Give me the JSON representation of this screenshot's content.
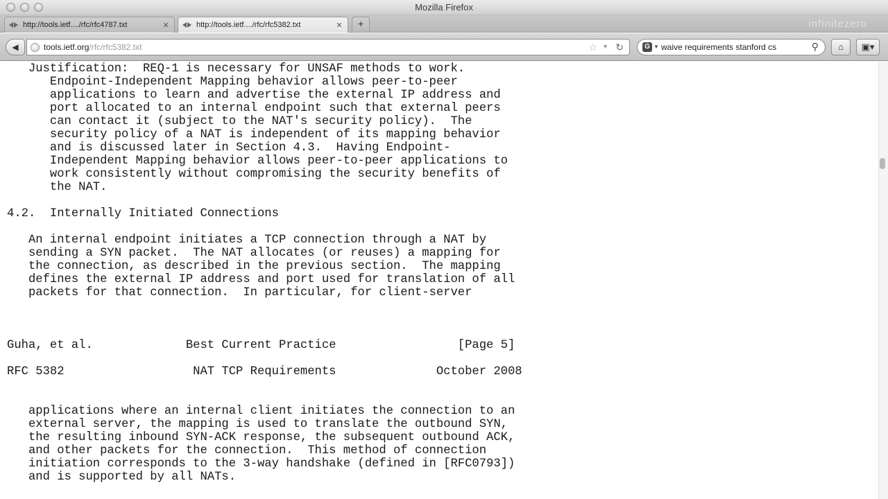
{
  "window": {
    "title": "Mozilla Firefox",
    "watermark": "infinitezero"
  },
  "tabs": [
    {
      "label": "http://tools.ietf..../rfc/rfc4787.txt",
      "close": "✕",
      "active": false
    },
    {
      "label": "http://tools.ietf..../rfc/rfc5382.txt",
      "close": "✕",
      "active": true
    }
  ],
  "newtab": {
    "label": "+"
  },
  "navbar": {
    "back_icon": "◀",
    "url_host": "tools.ietf.org",
    "url_path": "/rfc/rfc5382.txt",
    "star_icon": "☆",
    "drop_icon": "▼",
    "reload_icon": "↻",
    "search_value": "waive requirements stanford cs",
    "search_engine_letter": "G",
    "search_engine_drop": "▼",
    "search_icon": "⚲",
    "home_icon": "⌂",
    "addon_icon": "▣▾"
  },
  "document": {
    "lines": [
      "   Justification:  REQ-1 is necessary for UNSAF methods to work.",
      "      Endpoint-Independent Mapping behavior allows peer-to-peer",
      "      applications to learn and advertise the external IP address and",
      "      port allocated to an internal endpoint such that external peers",
      "      can contact it (subject to the NAT's security policy).  The",
      "      security policy of a NAT is independent of its mapping behavior",
      "      and is discussed later in Section 4.3.  Having Endpoint-",
      "      Independent Mapping behavior allows peer-to-peer applications to",
      "      work consistently without compromising the security benefits of",
      "      the NAT.",
      "",
      "4.2.  Internally Initiated Connections",
      "",
      "   An internal endpoint initiates a TCP connection through a NAT by",
      "   sending a SYN packet.  The NAT allocates (or reuses) a mapping for",
      "   the connection, as described in the previous section.  The mapping",
      "   defines the external IP address and port used for translation of all",
      "   packets for that connection.  In particular, for client-server",
      "",
      "",
      "",
      "Guha, et al.             Best Current Practice                 [Page 5]",
      "",
      "RFC 5382                  NAT TCP Requirements              October 2008",
      "",
      "",
      "   applications where an internal client initiates the connection to an",
      "   external server, the mapping is used to translate the outbound SYN,",
      "   the resulting inbound SYN-ACK response, the subsequent outbound ACK,",
      "   and other packets for the connection.  This method of connection",
      "   initiation corresponds to the 3-way handshake (defined in [RFC0793])",
      "   and is supported by all NATs."
    ]
  }
}
